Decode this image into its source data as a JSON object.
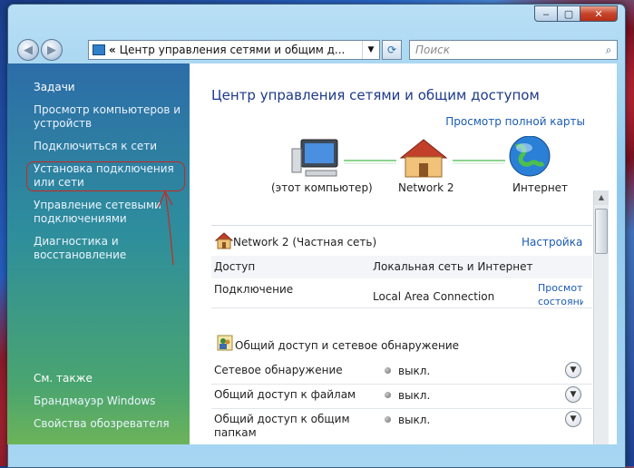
{
  "window": {
    "title_buttons": {
      "minimize": "‒",
      "maximize": "▢",
      "close": "✕"
    }
  },
  "nav": {
    "address_text": "Центр управления сетями и общим д...",
    "search_placeholder": "Поиск"
  },
  "sidebar": {
    "tasks_header": "Задачи",
    "items": [
      {
        "label": "Просмотр компьютеров и устройств"
      },
      {
        "label": "Подключиться к сети"
      },
      {
        "label": "Установка подключения или сети"
      },
      {
        "label": "Управление сетевыми подключениями"
      },
      {
        "label": "Диагностика и восстановление"
      }
    ],
    "see_also_header": "См. также",
    "see_also": [
      {
        "label": "Брандмауэр Windows"
      },
      {
        "label": "Свойства обозревателя"
      }
    ]
  },
  "main": {
    "title": "Центр управления сетями и общим доступом",
    "full_map_link": "Просмотр полной карты",
    "map_nodes": [
      {
        "label": "(этот компьютер)"
      },
      {
        "label": "Network  2"
      },
      {
        "label": "Интернет"
      }
    ],
    "network": {
      "title": "Network  2 (Частная сеть)",
      "settings_link": "Настройка",
      "access_label": "Доступ",
      "access_value": "Локальная сеть и Интернет",
      "connection_label": "Подключение",
      "connection_value": "Local Area Connection",
      "view_status_link": "Просмотр состояния"
    },
    "sharing": {
      "title": "Общий доступ и сетевое обнаружение",
      "rows": [
        {
          "label": "Сетевое обнаружение",
          "status": "выкл."
        },
        {
          "label": "Общий доступ к файлам",
          "status": "выкл."
        },
        {
          "label": "Общий доступ к общим папкам",
          "status": "выкл."
        }
      ]
    }
  }
}
